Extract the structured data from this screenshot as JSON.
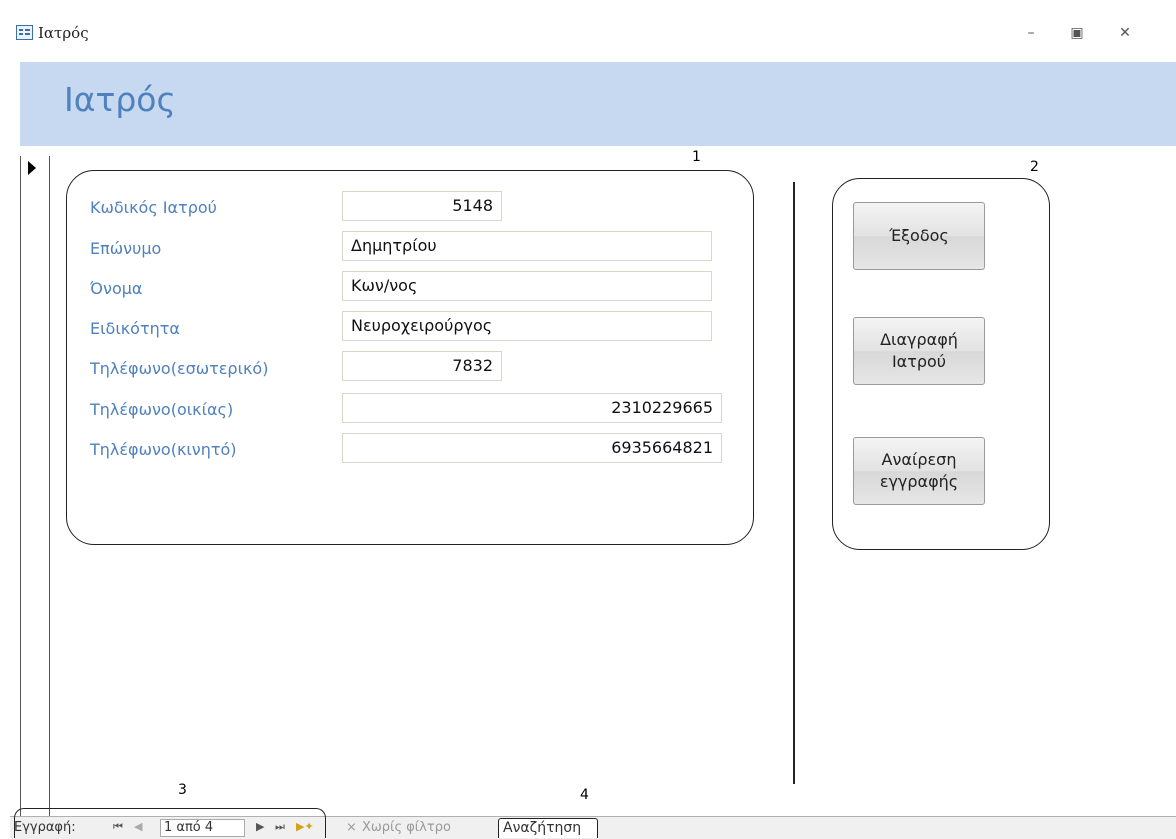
{
  "window": {
    "title": "Ιατρός",
    "minimize_icon": "minimize-icon",
    "restore_icon": "restore-icon",
    "close_icon": "close-icon"
  },
  "form": {
    "title": "Ιατρός",
    "fields": [
      {
        "label": "Κωδικός Ιατρού",
        "value": "5148"
      },
      {
        "label": "Επώνυμο",
        "value": "Δημητρίου"
      },
      {
        "label": "Όνομα",
        "value": "Κων/νος"
      },
      {
        "label": "Ειδικότητα",
        "value": "Νευροχειρούργος"
      },
      {
        "label": "Τηλέφωνο(εσωτερικό)",
        "value": "7832"
      },
      {
        "label": "Τηλέφωνο(οικίας)",
        "value": "2310229665"
      },
      {
        "label": "Τηλέφωνο(κινητό)",
        "value": "6935664821"
      }
    ],
    "buttons": {
      "exit": "Έξοδος",
      "delete_doctor": "Διαγραφή\nΙατρού",
      "undo_record": "Αναίρεση\nεγγραφής"
    }
  },
  "annotations": {
    "n1": "1",
    "n2": "2",
    "n3": "3",
    "n4": "4"
  },
  "status_bar": {
    "record_label": "Εγγραφή:",
    "record_position": "1 από 4",
    "filter_label": "Χωρίς φίλτρο",
    "search_label": "Αναζήτηση"
  }
}
